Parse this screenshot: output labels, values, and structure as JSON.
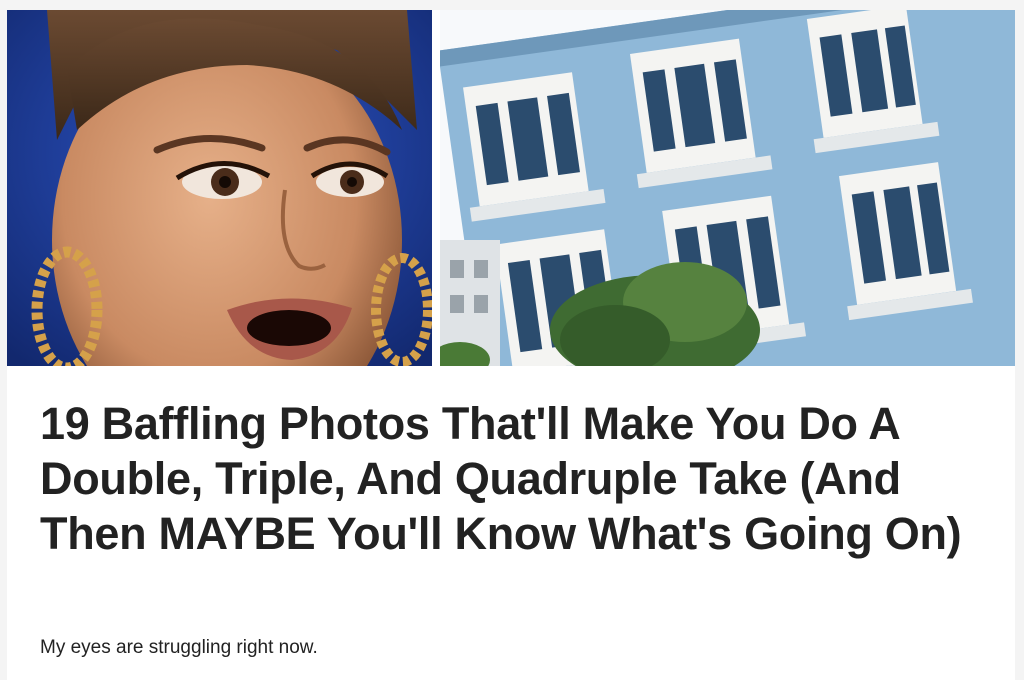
{
  "article": {
    "headline": "19 Baffling Photos That'll Make You Do A Double, Triple, And Quadruple Take (And Then MAYBE You'll Know What's Going On)",
    "subtitle": "My eyes are struggling right now."
  },
  "images": {
    "left": {
      "subject": "shocked-woman-photo"
    },
    "right": {
      "subject": "tilted-blue-building-photo"
    }
  },
  "colors": {
    "headline_text": "#222222",
    "building_blue": "#8fb8d8",
    "backdrop_blue": "#1f3f9a"
  }
}
